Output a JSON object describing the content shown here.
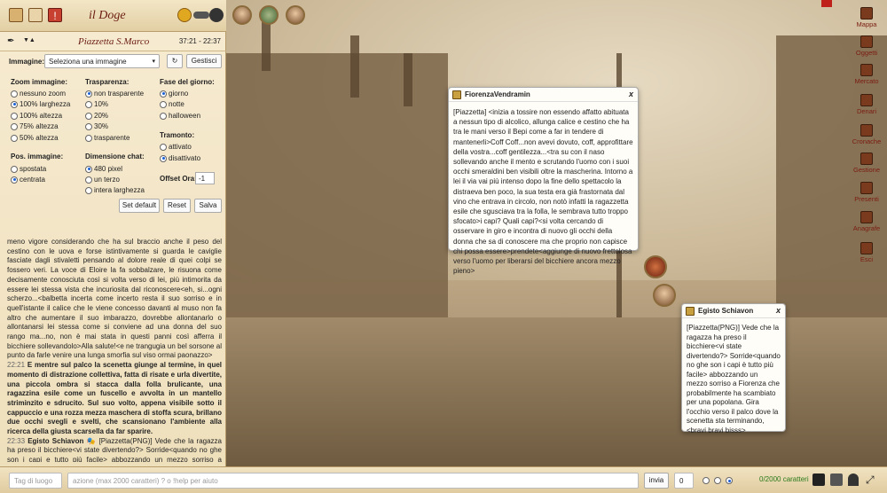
{
  "header": {
    "title": "il Doge"
  },
  "panel": {
    "location": "Piazzetta S.Marco",
    "time": "37:21 - 22:37",
    "image_label": "Immagine:",
    "image_select": "Seleziona una immagine",
    "manage_button": "Gestisci",
    "zoom": {
      "label": "Zoom immagine:",
      "options": [
        "nessuno zoom",
        "100% larghezza",
        "100% altezza",
        "75% altezza",
        "50% altezza"
      ]
    },
    "transparency": {
      "label": "Trasparenza:",
      "options": [
        "non trasparente",
        "10%",
        "20%",
        "30%",
        "trasparente"
      ]
    },
    "phase": {
      "label": "Fase del giorno:",
      "options": [
        "giorno",
        "notte",
        "halloween"
      ]
    },
    "sunset": {
      "label": "Tramonto:",
      "options": [
        "attivato",
        "disattivato"
      ]
    },
    "pos": {
      "label": "Pos. immagine:",
      "options": [
        "spostata",
        "centrata"
      ]
    },
    "chatdim": {
      "label": "Dimensione chat:",
      "options": [
        "480 pixel",
        "un terzo",
        "intera larghezza"
      ]
    },
    "offset": {
      "label": "Offset Ora:",
      "value": "-1"
    },
    "buttons": {
      "default": "Set default",
      "reset": "Reset",
      "save": "Salva"
    }
  },
  "log": {
    "p1": "meno vigore considerando che ha sul braccio anche il peso del cestino con le uova e forse istintivamente si guarda le caviglie fasciate dagli stivaletti pensando al dolore reale di quei colpi se fossero veri. La voce di Eloire la fa sobbalzare, le risuona come decisamente conosciuta così si volta verso di lei, più intimorita da essere lei stessa vista che incuriosita dal riconoscere<eh, si...ogni scherzo...<balbetta incerta come incerto resta il suo sorriso e in quell'istante il calice che le viene concesso davanti al muso non fa altro che aumentare il suo imbarazzo, dovrebbe allontanarlo o allontanarsi lei stessa come si conviene ad una donna del suo rango ma...no, non è mai stata in questi panni così afferra il bicchiere sollevandolo>Alla salute!<e ne trangugia un bel sorsone al punto da farle venire una lunga smorfia sul viso ormai paonazzo>",
    "t2": "22:21",
    "p2": "E mentre sul palco la scenetta giunge al termine, in quel momento di distrazione collettiva, fatta di risate e urla divertite, una piccola ombra si stacca dalla folla brulicante, una ragazzina esile come un fuscello e avvolta in un mantello striminzito e sdrucito. Sul suo volto, appena visibile sotto il cappuccio e una rozza mezza maschera di stoffa scura, brillano due occhi svegli e svelti, che scansionano l'ambiente alla ricerca della giusta scarsella da far sparire.",
    "t3": "22:33",
    "n3": "Egisto Schiavon",
    "p3": "[Piazzetta(PNG)] Vede che la ragazza ha preso il bicchiere<vi state divertendo?> Sorride<quando no ghe son i capi e tutto più facile> abbozzando un mezzo sorriso a Fiorenza che"
  },
  "popup1": {
    "name": "FiorenzaVendramin",
    "close": "x",
    "text": "[Piazzetta] <inizia a tossire non essendo affatto abituata a nessun tipo di alcolico, allunga calice e cestino che ha tra le mani verso il Bepi come a far in tendere di mantenerli>Coff Coff...non avevi dovuto, coff, approfittare della vostra...coff gentilezza...<tra su con il naso sollevando anche il mento e scrutando l'uomo con i suoi occhi smeraldini ben visibili oltre la mascherina. Intorno a lei il via vai più intenso dopo la fine dello spettacolo la distraeva ben poco, la sua testa era già frastornata dal vino che entrava in circolo, non notò infatti la ragazzetta esile che sgusciava tra la folla, le sembrava tutto troppo sfocato>i capi? Quali capi?<si volta cercando di osservare in giro e incontra di nuovo gli occhi della donna che sa di conoscere ma che proprio non capisce chi possa essere>prendete<aggiunge di nuovo frettolosa verso l'uomo per liberarsi del bicchiere ancora mezzo pieno>"
  },
  "popup2": {
    "name": "Egisto Schiavon",
    "close": "x",
    "text": "[Piazzetta(PNG)] Vede che la ragazza ha preso il bicchiere<vi state divertendo?> Sorride<quando no ghe son i capi è tutto più facile> abbozzando un mezzo sorriso a Fiorenza che probabilmente ha scambiato per una popolana. Gira l'occhio verso il palco dove la scenetta sta terminando,<bravi bravi bisss>"
  },
  "rmenu": [
    "Mappa",
    "Oggetti",
    "Mercato",
    "Denari",
    "Cronache",
    "Gestione",
    "Presenti",
    "Anagrafe",
    "Esci"
  ],
  "bottom": {
    "tag_placeholder": "Tag di luogo",
    "action_placeholder": "azione (max 2000 caratteri) ? o !help per aiuto",
    "send": "invia",
    "count": "0",
    "chars": "0/2000 caratteri"
  }
}
